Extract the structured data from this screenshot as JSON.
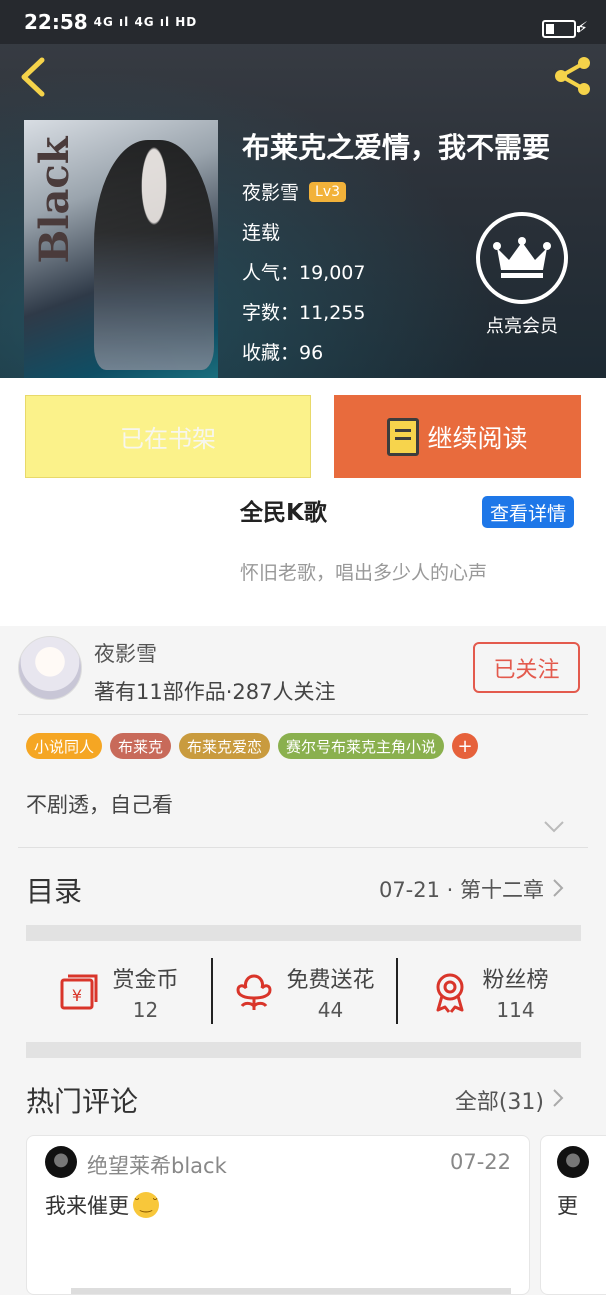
{
  "status_bar": {
    "time": "22:58",
    "signals": "4G ıl  4G ıl  HD"
  },
  "book": {
    "title": "布莱克之爱情，我不需要",
    "author": "夜影雪",
    "level": "Lv3",
    "status": "连载",
    "popularity": "人气：19,007",
    "words": "字数：11,255",
    "favorites": "收藏：96",
    "cover_text": "Black"
  },
  "vip": {
    "label": "点亮会员"
  },
  "actions": {
    "shelf_label": "已在书架",
    "read_label": "继续阅读"
  },
  "ad": {
    "title": "全民K歌",
    "detail_label": "查看详情",
    "subtitle": "怀旧老歌，唱出多少人的心声"
  },
  "author": {
    "name": "夜影雪",
    "stats": "著有11部作品·287人关注",
    "follow_label": "已关注"
  },
  "tags": [
    {
      "label": "小说同人",
      "color": "#f5a623"
    },
    {
      "label": "布莱克",
      "color": "#c86a5a"
    },
    {
      "label": "布莱克爱恋",
      "color": "#c99b3e"
    },
    {
      "label": "赛尔号布莱克主角小说",
      "color": "#8ab04e"
    }
  ],
  "tag_add": "+",
  "intro": "不剧透，自己看",
  "catalog": {
    "title": "目录",
    "latest": "07-21 · 第十二章"
  },
  "stats": [
    {
      "label": "赏金币",
      "value": "12",
      "icon": "red-envelope-icon"
    },
    {
      "label": "免费送花",
      "value": "44",
      "icon": "flower-icon"
    },
    {
      "label": "粉丝榜",
      "value": "114",
      "icon": "award-icon"
    }
  ],
  "comments": {
    "title": "热门评论",
    "all_label": "全部(31)",
    "items": [
      {
        "user": "绝望莱希black",
        "date": "07-22",
        "text": "我来催更"
      },
      {
        "user": "",
        "date": "",
        "text": "更"
      }
    ]
  },
  "colors": {
    "accent_orange": "#e86b3d",
    "shelf_yellow": "#fbf28a",
    "follow_red": "#e35a4d",
    "ad_blue": "#1e77e8"
  }
}
